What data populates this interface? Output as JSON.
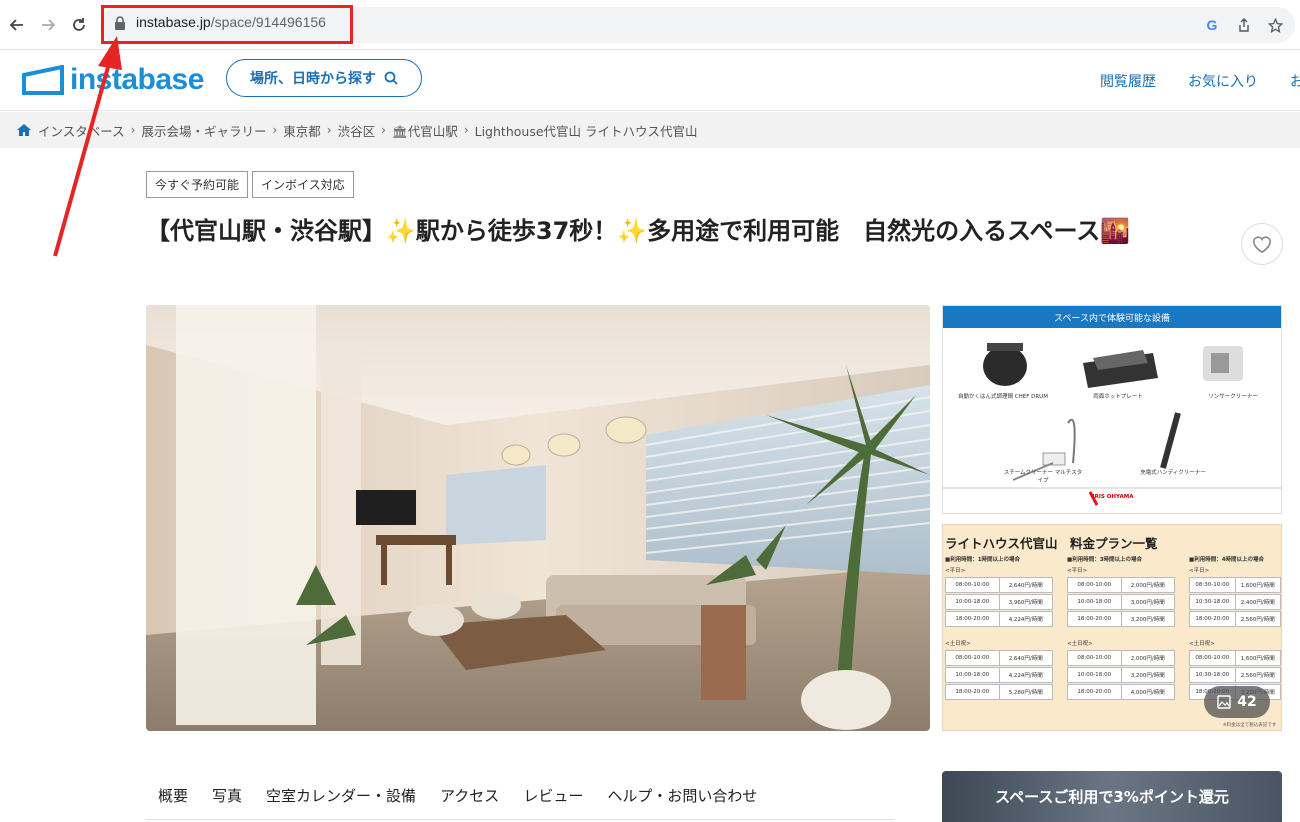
{
  "browser": {
    "url_domain": "instabase.jp",
    "url_path": "/space/914496156"
  },
  "header": {
    "logo_text": "instabase",
    "search_label": "場所、日時から探す",
    "links": [
      "閲覧履歴",
      "お気に入り",
      "お"
    ]
  },
  "breadcrumb": [
    "インスタベース",
    "展示会場・ギャラリー",
    "東京都",
    "渋谷区",
    "🏛代官山駅",
    "Lighthouse代官山 ライトハウス代官山"
  ],
  "tags": [
    "今すぐ予約可能",
    "インボイス対応"
  ],
  "title": "【代官山駅・渋谷駅】✨駅から徒歩37秒！✨多用途で利用可能　自然光の入るスペース🌇",
  "equipment_panel": {
    "heading": "スペース内で体験可能な設備",
    "items": [
      "自動かくはん式調理鍋 CHEF DRUM",
      "両面ホットプレート",
      "リンサークリーナー",
      "スチームクリーナー マルチスタイプ",
      "充電式ハンディクリーナー"
    ],
    "brand": "IRIS OHYAMA"
  },
  "price_panel": {
    "title": "ライトハウス代官山　料金プラン一覧",
    "columns": [
      {
        "heading": "■利用時間：1時間以上の場合",
        "weekday_label": "<平日>",
        "weekday": [
          [
            "08:00-10:00",
            "2,640円/時間"
          ],
          [
            "10:00-18:00",
            "3,960円/時間"
          ],
          [
            "18:00-20:00",
            "4,224円/時間"
          ]
        ],
        "holiday_label": "<土日祝>",
        "holiday": [
          [
            "08:00-10:00",
            "2,640円/時間"
          ],
          [
            "10:00-18:00",
            "4,224円/時間"
          ],
          [
            "18:00-20:00",
            "5,280円/時間"
          ]
        ]
      },
      {
        "heading": "■利用時間：3時間以上の場合",
        "weekday_label": "<平日>",
        "weekday": [
          [
            "08:00-10:00",
            "2,000円/時間"
          ],
          [
            "10:00-18:00",
            "3,000円/時間"
          ],
          [
            "18:00-20:00",
            "3,200円/時間"
          ]
        ],
        "holiday_label": "<土日祝>",
        "holiday": [
          [
            "08:00-10:00",
            "2,000円/時間"
          ],
          [
            "10:00-18:00",
            "3,200円/時間"
          ],
          [
            "18:00-20:00",
            "4,000円/時間"
          ]
        ]
      },
      {
        "heading": "■利用時間：4時間以上の場合",
        "weekday_label": "<平日>",
        "weekday": [
          [
            "08:30-10:00",
            "1,600円/時間"
          ],
          [
            "10:30-18:00",
            "2,400円/時間"
          ],
          [
            "18:00-20:00",
            "2,560円/時間"
          ]
        ],
        "holiday_label": "<土日祝>",
        "holiday": [
          [
            "08:00-10:00",
            "1,600円/時間"
          ],
          [
            "10:30-18:00",
            "2,560円/時間"
          ],
          [
            "18:00-20:00",
            "3,200円/時間"
          ]
        ]
      }
    ],
    "footnote": "※料金は全て税込表記です"
  },
  "photo_count": "42",
  "tabs": [
    "概要",
    "写真",
    "空室カレンダー・設備",
    "アクセス",
    "レビュー",
    "ヘルプ・お問い合わせ"
  ],
  "promo_text": "スペースご利用で3%ポイント還元",
  "colors": {
    "brand": "#1a8fd8",
    "link": "#1a6fb5",
    "annotation": "#e52424"
  }
}
